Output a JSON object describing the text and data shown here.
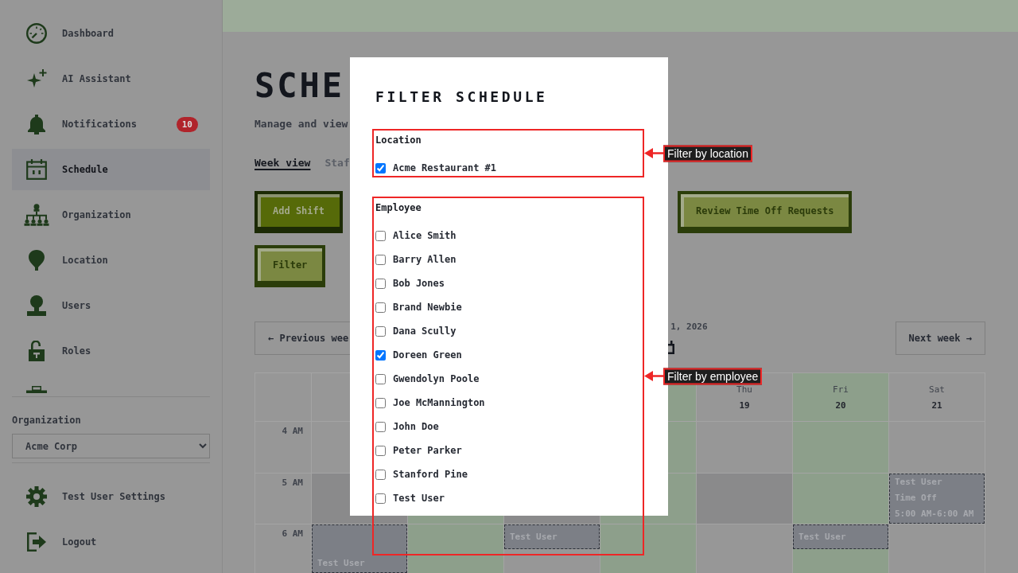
{
  "sidebar": {
    "items": [
      {
        "label": "Dashboard",
        "selected": false
      },
      {
        "label": "AI Assistant",
        "selected": false
      },
      {
        "label": "Notifications",
        "selected": false,
        "badge": "10"
      },
      {
        "label": "Schedule",
        "selected": true
      },
      {
        "label": "Organization",
        "selected": false
      },
      {
        "label": "Location",
        "selected": false
      },
      {
        "label": "Users",
        "selected": false
      },
      {
        "label": "Roles",
        "selected": false
      }
    ],
    "organization": {
      "label": "Organization",
      "value": "Acme Corp"
    },
    "footer_items": [
      {
        "label": "Test User Settings"
      },
      {
        "label": "Logout"
      }
    ]
  },
  "main": {
    "title": "SCHE",
    "subtitle": "Manage and view",
    "tabs": [
      {
        "label": "Week view",
        "selected": true
      },
      {
        "label": "Staf",
        "selected": false
      }
    ],
    "toolbar_rows": [
      {
        "buttons": [
          {
            "label": "Add Shift",
            "kind": "primary"
          },
          {
            "label": "Review Time Off Requests",
            "kind": "secondary"
          }
        ]
      },
      {
        "buttons": [
          {
            "label": "Filter",
            "kind": "secondary"
          }
        ]
      }
    ],
    "week_nav": {
      "previous": "← Previous wee",
      "range": "1, 2026",
      "next": "Next week →"
    },
    "calendar": {
      "days": [
        {
          "highlighted": false
        },
        {
          "highlighted": true
        },
        {
          "highlighted": false
        },
        {
          "highlighted": true
        },
        {
          "weekday": "Thu",
          "date": "19",
          "highlighted": false
        },
        {
          "weekday": "Fri",
          "date": "20",
          "highlighted": true
        },
        {
          "weekday": "Sat",
          "date": "21",
          "highlighted": false
        }
      ],
      "rows": [
        {
          "time": "4 AM",
          "shaded": false,
          "cells": [
            {},
            {},
            {},
            {},
            {},
            {},
            {}
          ]
        },
        {
          "time": "5 AM",
          "shaded": true,
          "cells": [
            {},
            {},
            {},
            {},
            {},
            {},
            {
              "events": [
                {
                  "kind": "time_off",
                  "name": "Test User",
                  "type": "Time Off",
                  "time": "5:00 AM-6:00 AM"
                }
              ]
            }
          ]
        },
        {
          "time": "6 AM",
          "shaded": false,
          "cells": [
            {
              "events": [
                {
                  "kind": "time_off",
                  "name": "Test User"
                }
              ]
            },
            {},
            {
              "events": [
                {
                  "kind": "shift",
                  "name": "Test User"
                }
              ]
            },
            {},
            {},
            {
              "events": [
                {
                  "kind": "shift",
                  "name": "Test User"
                }
              ]
            },
            {}
          ]
        }
      ]
    }
  },
  "modal": {
    "title": "FILTER SCHEDULE",
    "groups": [
      {
        "label": "Location",
        "annotation": "Filter by location",
        "options": [
          {
            "label": "Acme Restaurant #1",
            "checked": true
          }
        ]
      },
      {
        "label": "Employee",
        "annotation": "Filter by employee",
        "options": [
          {
            "label": "Alice Smith",
            "checked": false
          },
          {
            "label": "Barry Allen",
            "checked": false
          },
          {
            "label": "Bob Jones",
            "checked": false
          },
          {
            "label": "Brand Newbie",
            "checked": false
          },
          {
            "label": "Dana Scully",
            "checked": false
          },
          {
            "label": "Doreen Green",
            "checked": true
          },
          {
            "label": "Gwendolyn Poole",
            "checked": false
          },
          {
            "label": "Joe McMannington",
            "checked": false
          },
          {
            "label": "John Doe",
            "checked": false
          },
          {
            "label": "Peter Parker",
            "checked": false
          },
          {
            "label": "Stanford Pine",
            "checked": false
          },
          {
            "label": "Test User",
            "checked": false
          }
        ]
      }
    ]
  }
}
